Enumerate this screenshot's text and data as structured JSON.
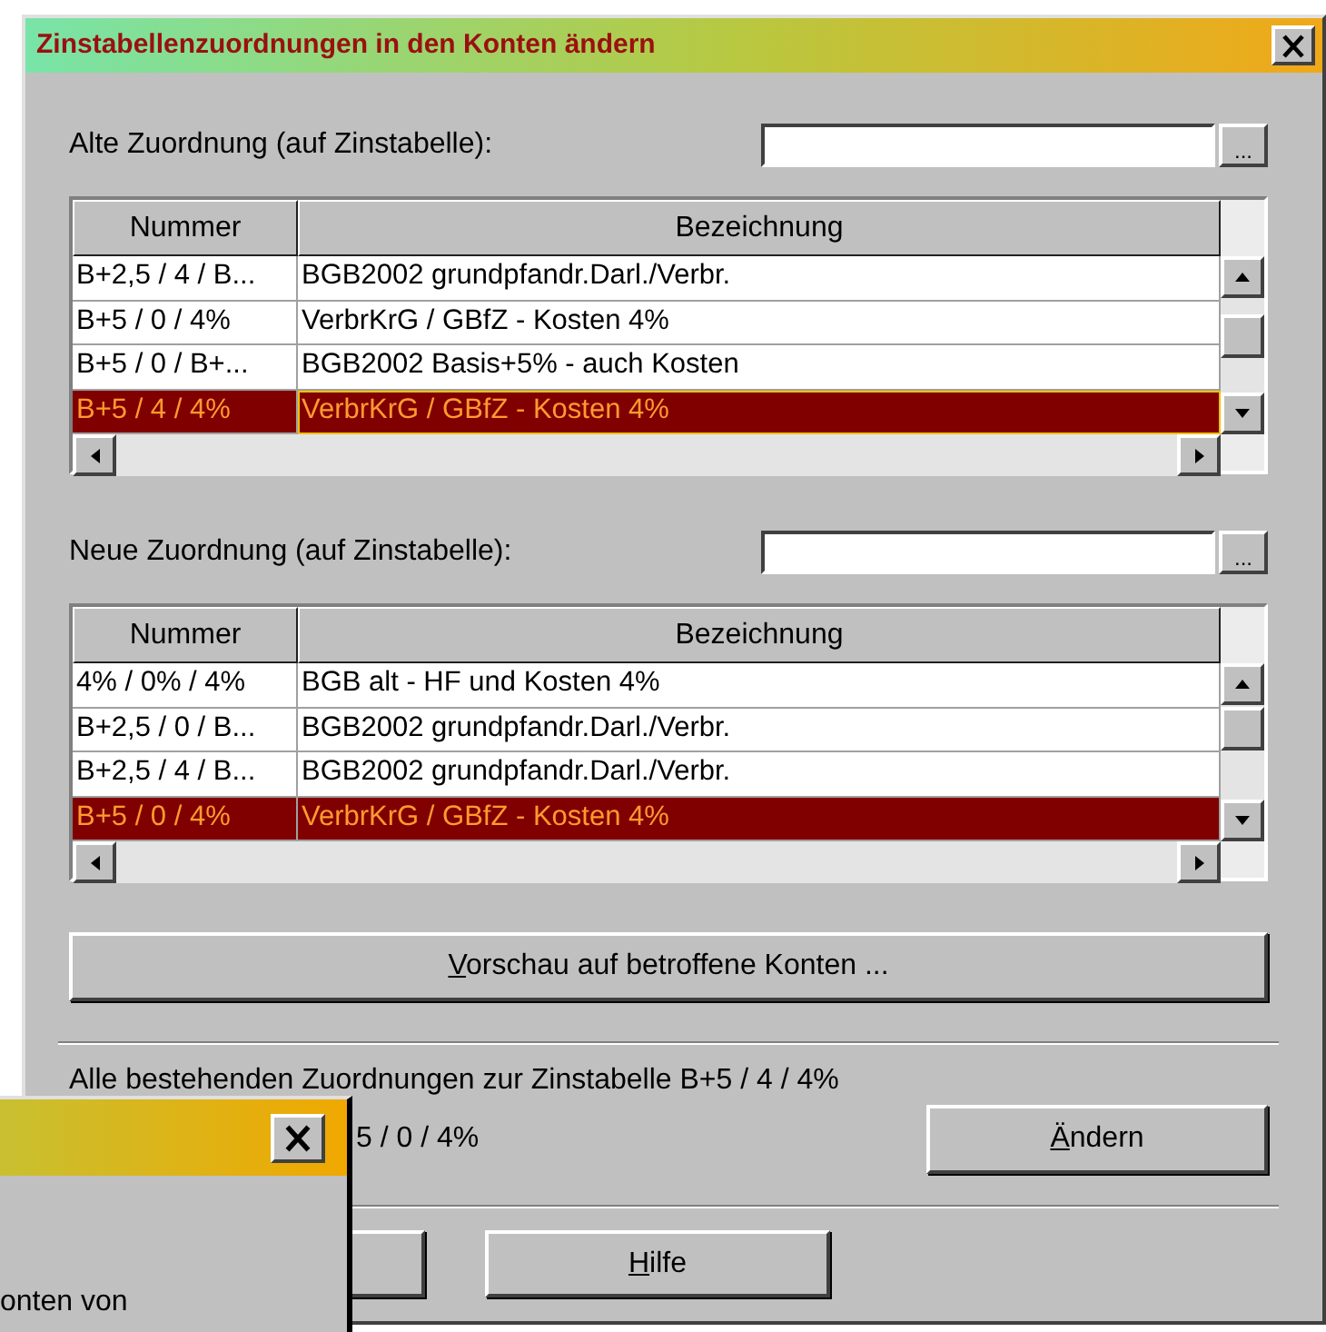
{
  "window": {
    "title": "Zinstabellenzuordnungen in den Konten ändern"
  },
  "old_assignment": {
    "label": "Alte Zuordnung (auf Zinstabelle):",
    "browse_button": "...",
    "table": {
      "focused": true,
      "columns": [
        "Nummer",
        "Bezeichnung"
      ],
      "rows": [
        {
          "cells": [
            "B+2,5 / 4 / B...",
            "BGB2002 grundpfandr.Darl./Verbr."
          ],
          "selected": false
        },
        {
          "cells": [
            "B+5 / 0 / 4%",
            "VerbrKrG / GBfZ - Kosten 4%"
          ],
          "selected": false
        },
        {
          "cells": [
            "B+5 / 0 / B+...",
            "BGB2002 Basis+5% - auch Kosten"
          ],
          "selected": false
        },
        {
          "cells": [
            "B+5 / 4 / 4%",
            "VerbrKrG / GBfZ - Kosten 4%"
          ],
          "selected": true
        }
      ]
    }
  },
  "new_assignment": {
    "label": "Neue Zuordnung (auf Zinstabelle):",
    "browse_button": "...",
    "table": {
      "focused": false,
      "columns": [
        "Nummer",
        "Bezeichnung"
      ],
      "rows": [
        {
          "cells": [
            "4% / 0% / 4%",
            "BGB alt - HF und Kosten 4%"
          ],
          "selected": false
        },
        {
          "cells": [
            "B+2,5 / 0 / B...",
            "BGB2002 grundpfandr.Darl./Verbr."
          ],
          "selected": false
        },
        {
          "cells": [
            "B+2,5 / 4 / B...",
            "BGB2002 grundpfandr.Darl./Verbr."
          ],
          "selected": false
        },
        {
          "cells": [
            "B+5 / 0 / 4%",
            "VerbrKrG / GBfZ - Kosten 4%"
          ],
          "selected": true
        }
      ]
    }
  },
  "preview_button": {
    "accel": "V",
    "rest": "orschau auf betroffene Konten ..."
  },
  "summary": {
    "line_1": "Alle bestehenden Zuordnungen zur Zinstabelle B+5 / 4 / 4%",
    "line_2": "5 / 0 / 4%"
  },
  "change_button": {
    "accel": "Ä",
    "rest": "ndern"
  },
  "help_button": {
    "accel": "H",
    "rest": "ilfe"
  },
  "overlay_dialog": {
    "text": "onten von"
  }
}
